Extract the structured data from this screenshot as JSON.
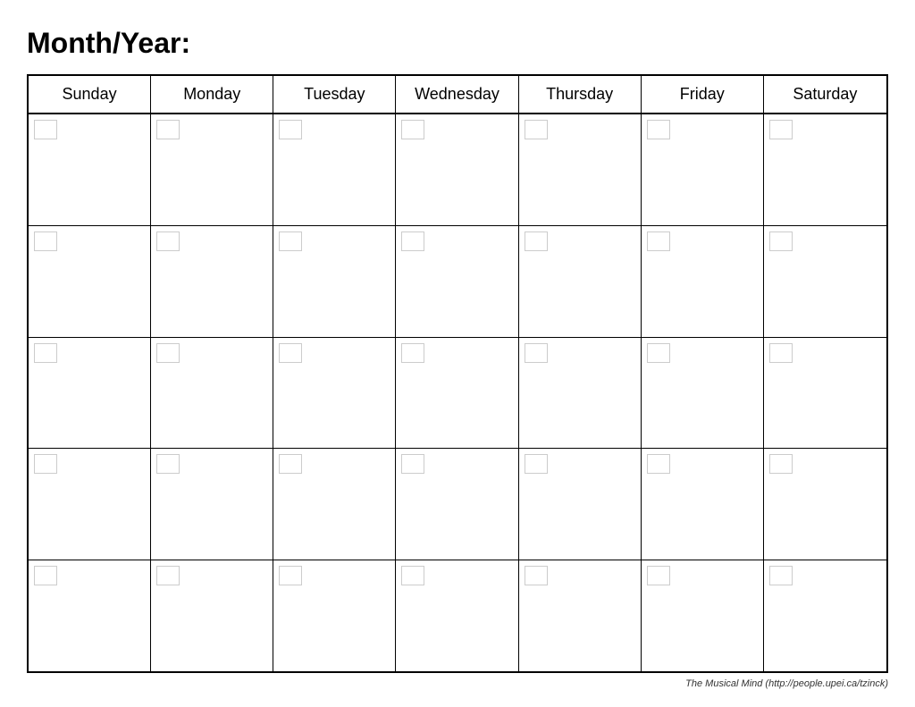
{
  "title": "Month/Year:",
  "days": [
    "Sunday",
    "Monday",
    "Tuesday",
    "Wednesday",
    "Thursday",
    "Friday",
    "Saturday"
  ],
  "rows": 5,
  "footer": "The Musical Mind  (http://people.upei.ca/tzinck)"
}
